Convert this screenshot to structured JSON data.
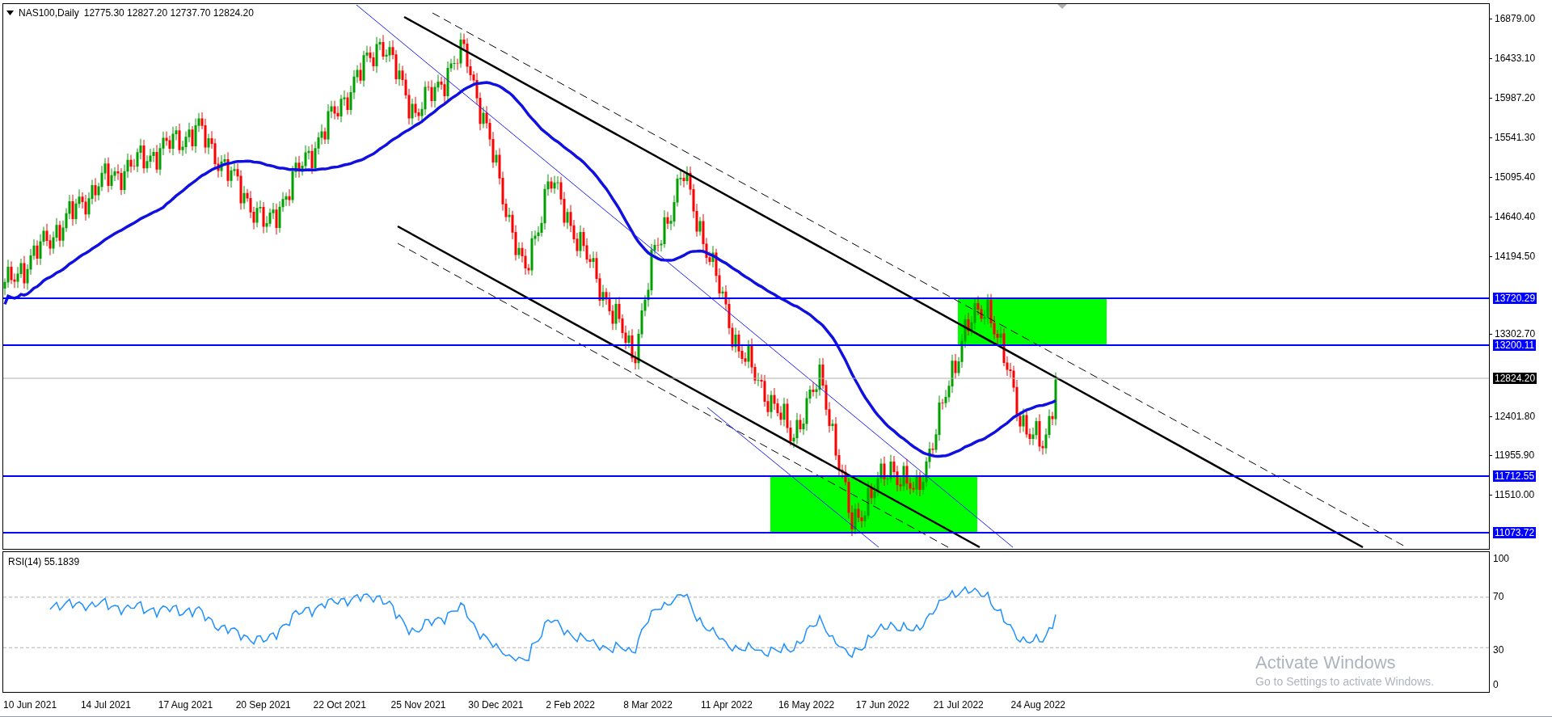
{
  "chart": {
    "symbol": "NAS100,Daily",
    "ohlc": "12775.30 12827.20 12737.70 12824.20"
  },
  "price_axis": [
    {
      "label": "16879.00",
      "kind": "tick"
    },
    {
      "label": "16433.10",
      "kind": "tick"
    },
    {
      "label": "15987.20",
      "kind": "tick"
    },
    {
      "label": "15541.30",
      "kind": "tick"
    },
    {
      "label": "15095.40",
      "kind": "tick"
    },
    {
      "label": "14640.40",
      "kind": "tick"
    },
    {
      "label": "14194.50",
      "kind": "tick"
    },
    {
      "label": "13720.29",
      "kind": "level"
    },
    {
      "label": "13302.70",
      "kind": "tick"
    },
    {
      "label": "13200.11",
      "kind": "level"
    },
    {
      "label": "12824.20",
      "kind": "current"
    },
    {
      "label": "12401.80",
      "kind": "tick"
    },
    {
      "label": "11955.90",
      "kind": "tick"
    },
    {
      "label": "11712.55",
      "kind": "level"
    },
    {
      "label": "11510.00",
      "kind": "tick"
    },
    {
      "label": "11073.72",
      "kind": "level"
    }
  ],
  "rsi_panel": {
    "title": "RSI(14) 55.1839",
    "axis": [
      "100",
      "70",
      "30",
      "0"
    ]
  },
  "date_axis": [
    "10 Jun 2021",
    "14 Jul 2021",
    "17 Aug 2021",
    "20 Sep 2021",
    "22 Oct 2021",
    "25 Nov 2021",
    "30 Dec 2021",
    "2 Feb 2022",
    "8 Mar 2022",
    "11 Apr 2022",
    "16 May 2022",
    "17 Jun 2022",
    "21 Jul 2022",
    "24 Aug 2022"
  ],
  "os_overlay": {
    "title": "Activate Windows",
    "message": "Go to Settings to activate Windows."
  }
}
